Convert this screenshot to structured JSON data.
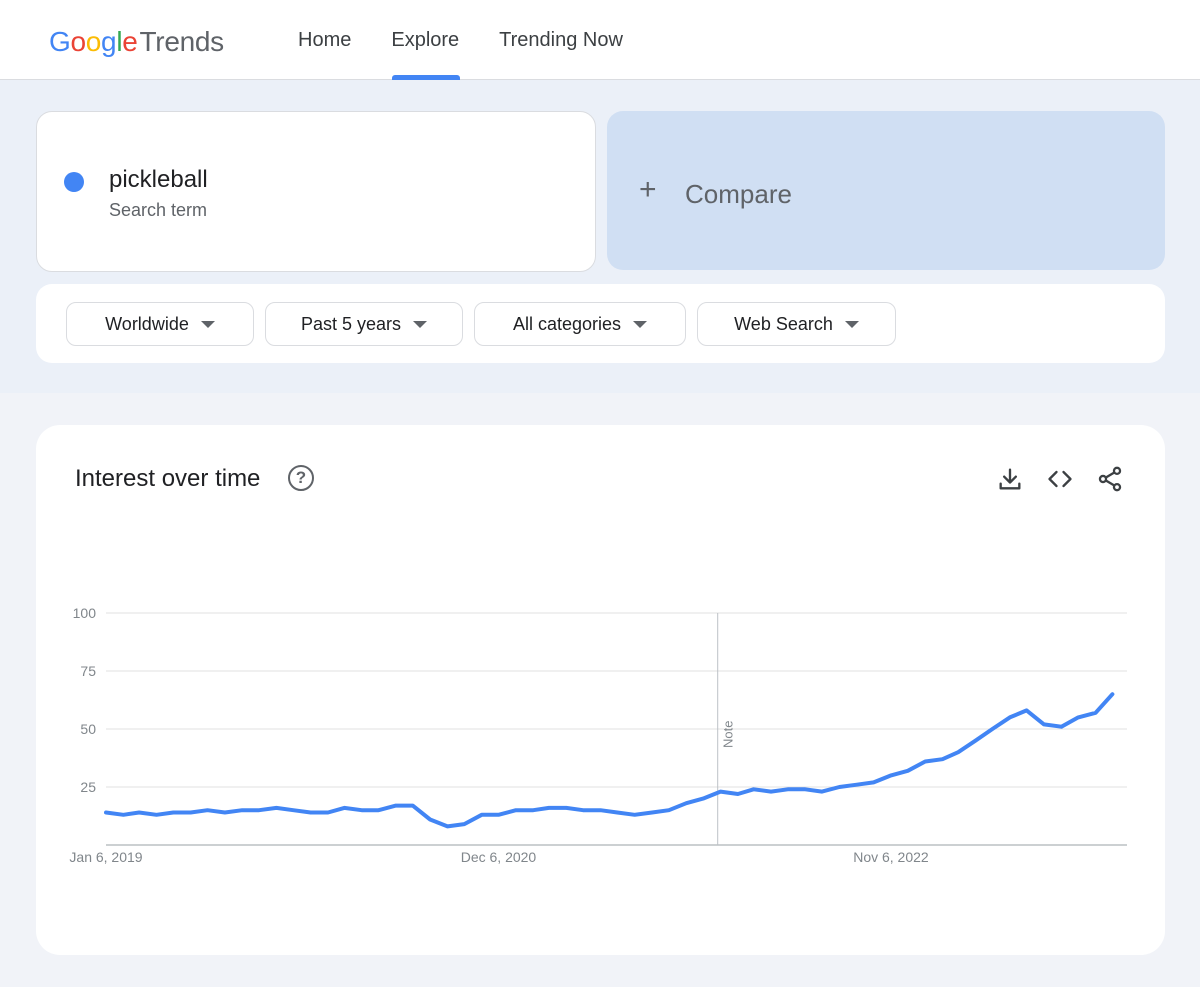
{
  "header": {
    "logo": {
      "g1": "G",
      "o1": "o",
      "o2": "o",
      "g2": "g",
      "l": "l",
      "e": "e",
      "trends": "Trends"
    },
    "nav": [
      {
        "label": "Home",
        "active": false
      },
      {
        "label": "Explore",
        "active": true
      },
      {
        "label": "Trending Now",
        "active": false
      }
    ]
  },
  "search": {
    "term": "pickleball",
    "term_type": "Search term",
    "term_color": "#4285f4",
    "compare_label": "Compare"
  },
  "filters": {
    "region": "Worldwide",
    "time_range": "Past 5 years",
    "category": "All categories",
    "search_type": "Web Search"
  },
  "chart_panel": {
    "title": "Interest over time",
    "icons": [
      "help-icon",
      "download-icon",
      "embed-icon",
      "share-icon"
    ],
    "note_label": "Note"
  },
  "chart_data": {
    "type": "line",
    "title": "Interest over time",
    "xlabel": "",
    "ylabel": "",
    "ylim": [
      0,
      100
    ],
    "y_ticks": [
      "25",
      "50",
      "75",
      "100"
    ],
    "x_tick_labels": [
      "Jan 6, 2019",
      "Dec 6, 2020",
      "Nov 6, 2022"
    ],
    "x_range": [
      "2019-01-06",
      "2024-01-01"
    ],
    "note_date": "2022-01-01",
    "grid": true,
    "series": [
      {
        "color": "#4285f4",
        "points": [
          [
            "2019-01-06",
            14
          ],
          [
            "2019-02-06",
            13
          ],
          [
            "2019-03-06",
            14
          ],
          [
            "2019-04-06",
            13
          ],
          [
            "2019-05-06",
            14
          ],
          [
            "2019-06-06",
            14
          ],
          [
            "2019-07-06",
            15
          ],
          [
            "2019-08-06",
            14
          ],
          [
            "2019-09-06",
            15
          ],
          [
            "2019-10-06",
            15
          ],
          [
            "2019-11-06",
            16
          ],
          [
            "2019-12-06",
            15
          ],
          [
            "2020-01-06",
            14
          ],
          [
            "2020-02-06",
            14
          ],
          [
            "2020-03-06",
            16
          ],
          [
            "2020-04-06",
            15
          ],
          [
            "2020-05-06",
            15
          ],
          [
            "2020-06-06",
            17
          ],
          [
            "2020-07-06",
            17
          ],
          [
            "2020-08-06",
            11
          ],
          [
            "2020-09-06",
            8
          ],
          [
            "2020-10-06",
            9
          ],
          [
            "2020-11-06",
            13
          ],
          [
            "2020-12-06",
            13
          ],
          [
            "2021-01-06",
            15
          ],
          [
            "2021-02-06",
            15
          ],
          [
            "2021-03-06",
            16
          ],
          [
            "2021-04-06",
            16
          ],
          [
            "2021-05-06",
            15
          ],
          [
            "2021-06-06",
            15
          ],
          [
            "2021-07-06",
            14
          ],
          [
            "2021-08-06",
            13
          ],
          [
            "2021-09-06",
            14
          ],
          [
            "2021-10-06",
            15
          ],
          [
            "2021-11-06",
            18
          ],
          [
            "2021-12-06",
            20
          ],
          [
            "2022-01-06",
            23
          ],
          [
            "2022-02-06",
            22
          ],
          [
            "2022-03-06",
            24
          ],
          [
            "2022-04-06",
            23
          ],
          [
            "2022-05-06",
            24
          ],
          [
            "2022-06-06",
            24
          ],
          [
            "2022-07-06",
            23
          ],
          [
            "2022-08-06",
            25
          ],
          [
            "2022-09-06",
            26
          ],
          [
            "2022-10-06",
            27
          ],
          [
            "2022-11-06",
            30
          ],
          [
            "2022-12-06",
            32
          ],
          [
            "2023-01-06",
            36
          ],
          [
            "2023-02-06",
            37
          ],
          [
            "2023-03-06",
            40
          ],
          [
            "2023-04-06",
            45
          ],
          [
            "2023-05-06",
            50
          ],
          [
            "2023-06-06",
            55
          ],
          [
            "2023-07-06",
            58
          ],
          [
            "2023-08-06",
            52
          ],
          [
            "2023-09-06",
            51
          ],
          [
            "2023-10-06",
            55
          ],
          [
            "2023-11-06",
            57
          ],
          [
            "2023-12-06",
            65
          ]
        ]
      }
    ]
  }
}
